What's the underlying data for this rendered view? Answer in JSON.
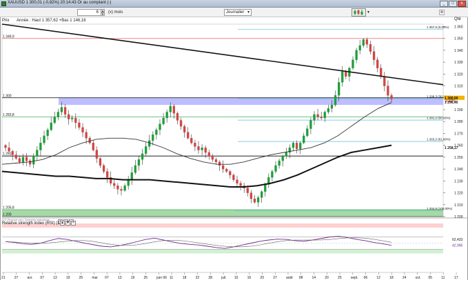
{
  "window": {
    "title": "XAUUSD  1 300,01 (-0,82%) 20:14:43 Or au comptant (-)",
    "min_label": "_",
    "max_label": "□",
    "close_label": "x"
  },
  "toolbar": {
    "period_value": "6",
    "period_unit": "(x) mois",
    "frequency": "Journalier",
    "qte_label": "Qté"
  },
  "price_panel": {
    "label": "Prix",
    "info": "Année : Haut 1 357,62 +Bas 1 146,16",
    "y_ticks": [
      "1 360",
      "1 350",
      "1 340",
      "1 330",
      "1 320",
      "1 310",
      "1 300",
      "1 290",
      "1 280",
      "1 270",
      "1 260",
      "1 250",
      "1 240",
      "1 230",
      "1 220",
      "1 210",
      "1 200"
    ],
    "left_labels": [
      "1 349,9",
      "1 300",
      "1 283,8",
      "1 251",
      "1 205,8",
      "1 200"
    ],
    "fib_labels": [
      "1 357,6 (0,00%)",
      "1 299,3 (38,20%)",
      "1 281,2 (50,00%)",
      "1 263,2 (61,80%)",
      "1 204,9 (100,00%)"
    ],
    "right_badges": [
      "1 300,00",
      "-0,82%",
      "1 296,45",
      "1 258,17"
    ],
    "source": "© F-Finance.com, Données indicatives"
  },
  "rsi_panel": {
    "label": "Relative strength index (RSI) (14)",
    "value_badges": [
      "62,433",
      "42,995"
    ]
  },
  "x_axis": {
    "labels": [
      "21",
      "27",
      "avr.",
      "07",
      "13",
      "19",
      "25",
      "mai",
      "07",
      "13",
      "19",
      "25",
      "juin 06",
      "11",
      "18",
      "22",
      "28",
      "juil.",
      "10",
      "16",
      "20",
      "27",
      "août",
      "08",
      "14",
      "20",
      "25",
      "sept.",
      "06",
      "12",
      "18",
      "24",
      "oct.",
      "05",
      "11",
      "17"
    ]
  },
  "colors": {
    "up": "#1e9e3a",
    "down": "#d24444",
    "support_zone": "#a8a8ff",
    "bottom_zone": "#8ed08e",
    "fib": "#5bc0de",
    "resistance": "#e04040",
    "rsi_line": "#6b2c8e",
    "rsi_zone_top": "#ffd0d0",
    "rsi_zone_bottom": "#d2f0d2"
  },
  "chart_data": {
    "type": "candlestick",
    "ylim": [
      1200,
      1362
    ],
    "candles_close": [
      1258,
      1255,
      1252,
      1249,
      1246,
      1250,
      1247,
      1244,
      1251,
      1256,
      1262,
      1268,
      1273,
      1279,
      1284,
      1288,
      1292,
      1286,
      1282,
      1283,
      1279,
      1275,
      1271,
      1266,
      1262,
      1256,
      1249,
      1243,
      1238,
      1233,
      1228,
      1226,
      1223,
      1222,
      1226,
      1231,
      1237,
      1243,
      1248,
      1253,
      1259,
      1264,
      1269,
      1273,
      1278,
      1283,
      1288,
      1293,
      1287,
      1281,
      1276,
      1271,
      1266,
      1262,
      1259,
      1256,
      1258,
      1254,
      1251,
      1248,
      1246,
      1243,
      1240,
      1238,
      1235,
      1231,
      1228,
      1226,
      1224,
      1220,
      1215,
      1212,
      1216,
      1221,
      1227,
      1233,
      1238,
      1243,
      1247,
      1251,
      1254,
      1258,
      1262,
      1257,
      1262,
      1268,
      1274,
      1281,
      1286,
      1284,
      1283,
      1288,
      1291,
      1294,
      1302,
      1313,
      1322,
      1318,
      1325,
      1332,
      1340,
      1344,
      1349,
      1345,
      1339,
      1332,
      1325,
      1318,
      1310,
      1302,
      1299
    ],
    "sma_long": [
      1238,
      1237,
      1236,
      1235,
      1234,
      1234,
      1233,
      1232,
      1232,
      1231,
      1231,
      1231,
      1230,
      1229,
      1228,
      1227,
      1226,
      1225,
      1225,
      1226,
      1228,
      1231,
      1235,
      1240,
      1245,
      1250,
      1254,
      1256,
      1258,
      1260
    ],
    "sma_short": [
      1244,
      1245,
      1246,
      1248,
      1252,
      1258,
      1262,
      1265,
      1266,
      1266,
      1265,
      1262,
      1258,
      1253,
      1249,
      1246,
      1244,
      1244,
      1246,
      1249,
      1252,
      1254,
      1256,
      1258,
      1262,
      1268,
      1276,
      1284,
      1291,
      1296
    ],
    "rsi": [
      55,
      52,
      48,
      46,
      50,
      58,
      65,
      62,
      56,
      50,
      45,
      40,
      38,
      42,
      48,
      55,
      62,
      66,
      60,
      54,
      49,
      46,
      44,
      40,
      36,
      33,
      38,
      44,
      50,
      56,
      60,
      63,
      62,
      58,
      56,
      60,
      65,
      70,
      72,
      68,
      62,
      58,
      52,
      48,
      42.995
    ],
    "trendline": {
      "from": [
        0,
        1362
      ],
      "to": [
        1,
        1311
      ]
    },
    "support_zone": [
      1294,
      1300
    ],
    "bottom_zone": [
      1200,
      1206
    ],
    "levels": [
      1349.9,
      1300,
      1283.8,
      1251,
      1205.8,
      1200
    ],
    "fib_levels": [
      1357.6,
      1299.3,
      1281.2,
      1263.2,
      1204.9
    ]
  }
}
